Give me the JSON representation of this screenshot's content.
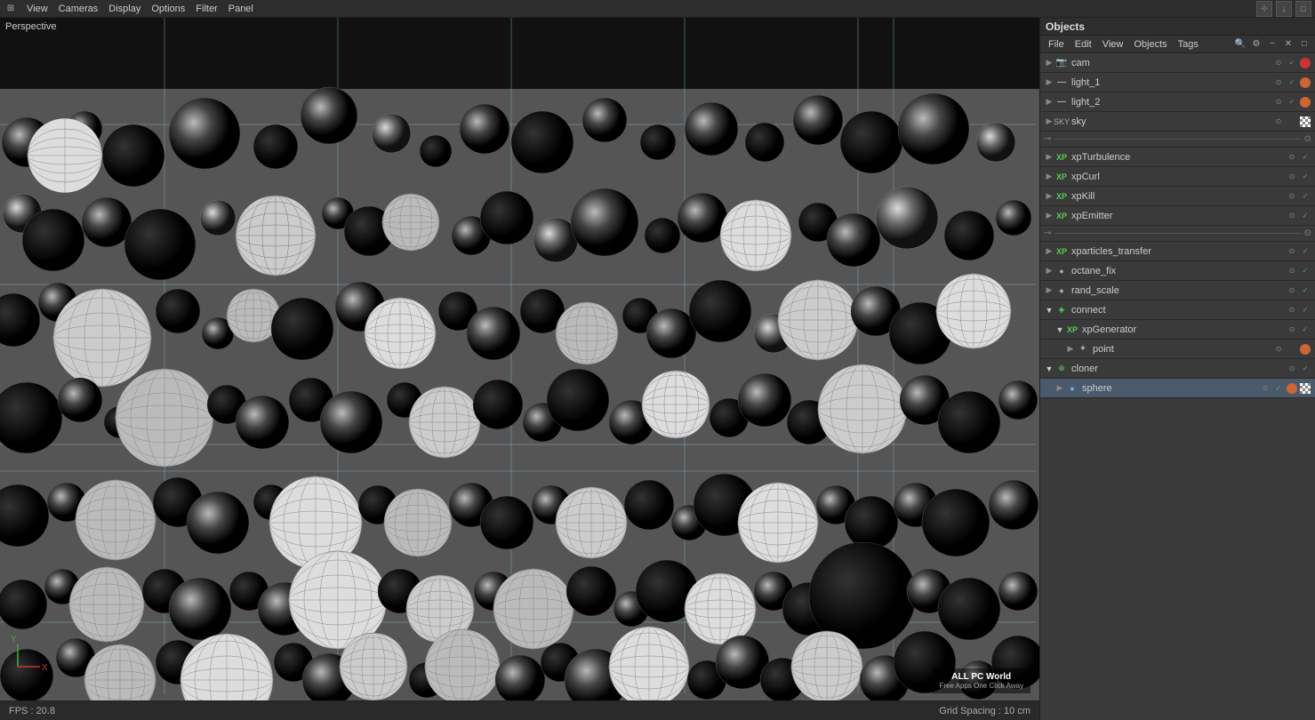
{
  "app": {
    "title": "Objects"
  },
  "menubar": {
    "items": [
      "View",
      "Cameras",
      "Display",
      "Options",
      "Filter",
      "Panel"
    ],
    "viewport_label": "Perspective"
  },
  "viewport": {
    "fps_label": "FPS : 20.8",
    "grid_spacing_label": "Grid Spacing : 10 cm",
    "axis": {
      "y_label": "Y",
      "x_label": "X"
    }
  },
  "watermark": {
    "title": "ALL PC World",
    "subtitle": "Free Apps One Click Away"
  },
  "panel": {
    "title": "Objects",
    "menu_items": [
      "File",
      "Edit",
      "View",
      "Objects",
      "Tags"
    ],
    "objects": [
      {
        "id": "cam",
        "name": "cam",
        "icon": "camera",
        "color": "red",
        "indent": 0,
        "expanded": false
      },
      {
        "id": "light_1",
        "name": "light_1",
        "icon": "light",
        "color": "orange",
        "indent": 0,
        "expanded": false
      },
      {
        "id": "light_2",
        "name": "light_2",
        "icon": "light",
        "color": "orange",
        "indent": 0,
        "expanded": false
      },
      {
        "id": "sky",
        "name": "sky",
        "icon": "sky",
        "color": "checker",
        "indent": 0,
        "expanded": false
      },
      {
        "id": "sep1",
        "name": "---separator---",
        "type": "separator"
      },
      {
        "id": "xpTurbulence",
        "name": "xpTurbulence",
        "icon": "xp",
        "color": "green",
        "indent": 0,
        "expanded": false
      },
      {
        "id": "xpCurl",
        "name": "xpCurl",
        "icon": "xp",
        "color": "green",
        "indent": 0,
        "expanded": false
      },
      {
        "id": "xpKill",
        "name": "xpKill",
        "icon": "xp",
        "color": "green",
        "indent": 0,
        "expanded": false
      },
      {
        "id": "xpEmitter",
        "name": "xpEmitter",
        "icon": "xp",
        "color": "green",
        "indent": 0,
        "expanded": false
      },
      {
        "id": "sep2",
        "name": "---separator---",
        "type": "separator"
      },
      {
        "id": "xparticles_transfer",
        "name": "xparticles_transfer",
        "icon": "xp",
        "color": "green",
        "indent": 0,
        "expanded": false
      },
      {
        "id": "octane_fix",
        "name": "octane_fix",
        "icon": "obj",
        "color": "gray",
        "indent": 0,
        "expanded": false
      },
      {
        "id": "rand_scale",
        "name": "rand_scale",
        "icon": "obj",
        "color": "gray",
        "indent": 0,
        "expanded": false
      },
      {
        "id": "connect",
        "name": "connect",
        "icon": "connect",
        "color": "gray",
        "indent": 0,
        "expanded": true
      },
      {
        "id": "xpGenerator",
        "name": "xpGenerator",
        "icon": "xpgen",
        "color": "gray",
        "indent": 1,
        "expanded": true
      },
      {
        "id": "point",
        "name": "point",
        "icon": "point",
        "color": "orange",
        "indent": 2,
        "expanded": false
      },
      {
        "id": "cloner",
        "name": "cloner",
        "icon": "cloner",
        "color": "gray",
        "indent": 0,
        "expanded": true
      },
      {
        "id": "sphere",
        "name": "sphere",
        "icon": "sphere",
        "color": "checker_orange",
        "indent": 1,
        "expanded": false,
        "selected": true
      }
    ]
  }
}
